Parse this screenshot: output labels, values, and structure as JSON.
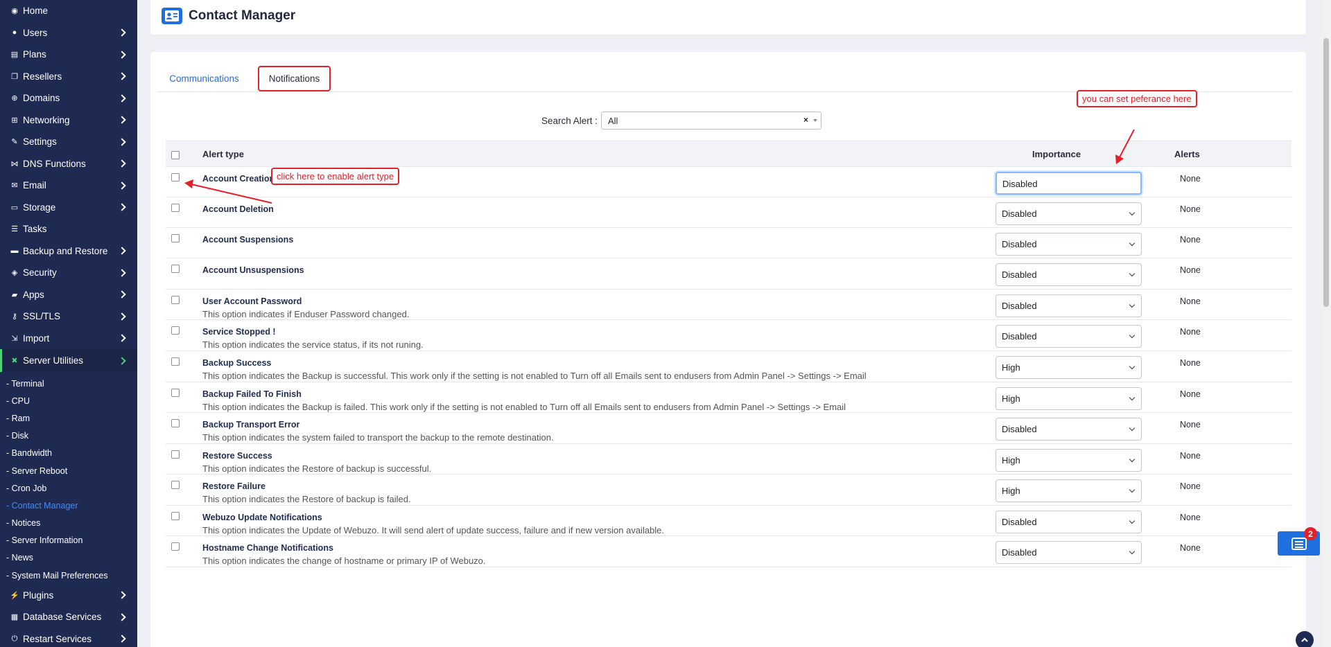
{
  "sidebar": {
    "items": [
      {
        "label": "Home",
        "icon": "home-icon",
        "has_children": false
      },
      {
        "label": "Users",
        "icon": "user-icon",
        "has_children": true
      },
      {
        "label": "Plans",
        "icon": "plans-icon",
        "has_children": true
      },
      {
        "label": "Resellers",
        "icon": "resellers-icon",
        "has_children": true
      },
      {
        "label": "Domains",
        "icon": "globe-icon",
        "has_children": true
      },
      {
        "label": "Networking",
        "icon": "network-icon",
        "has_children": true
      },
      {
        "label": "Settings",
        "icon": "wrench-icon",
        "has_children": true
      },
      {
        "label": "DNS Functions",
        "icon": "dns-icon",
        "has_children": true
      },
      {
        "label": "Email",
        "icon": "envelope-icon",
        "has_children": true
      },
      {
        "label": "Storage",
        "icon": "storage-icon",
        "has_children": true
      },
      {
        "label": "Tasks",
        "icon": "tasks-icon",
        "has_children": false
      },
      {
        "label": "Backup and Restore",
        "icon": "backup-icon",
        "has_children": true
      },
      {
        "label": "Security",
        "icon": "shield-icon",
        "has_children": true
      },
      {
        "label": "Apps",
        "icon": "apps-icon",
        "has_children": true
      },
      {
        "label": "SSL/TLS",
        "icon": "key-icon",
        "has_children": true
      },
      {
        "label": "Import",
        "icon": "import-icon",
        "has_children": true
      },
      {
        "label": "Server Utilities",
        "icon": "tools-icon",
        "has_children": true
      }
    ],
    "sub_items": [
      "- Terminal",
      "- CPU",
      "- Ram",
      "- Disk",
      "- Bandwidth",
      "- Server Reboot",
      "- Cron Job",
      "- Contact Manager",
      "- Notices",
      "- Server Information",
      "- News",
      "- System Mail Preferences"
    ],
    "bottom_items": [
      {
        "label": "Plugins",
        "icon": "plug-icon"
      },
      {
        "label": "Database Services",
        "icon": "database-icon"
      },
      {
        "label": "Restart Services",
        "icon": "power-icon"
      }
    ]
  },
  "header": {
    "title": "Contact Manager",
    "icon": "contact-card-icon"
  },
  "tabs": [
    {
      "label": "Communications"
    },
    {
      "label": "Notifications"
    }
  ],
  "search": {
    "label": "Search Alert :",
    "value": "All",
    "clear": "×"
  },
  "table": {
    "headers": {
      "alert_type": "Alert type",
      "importance": "Importance",
      "alerts": "Alerts"
    },
    "rows": [
      {
        "title": "Account Creation",
        "desc": "",
        "importance": "Disabled",
        "alerts": "None"
      },
      {
        "title": "Account Deletion",
        "desc": "",
        "importance": "Disabled",
        "alerts": "None"
      },
      {
        "title": "Account Suspensions",
        "desc": "",
        "importance": "Disabled",
        "alerts": "None"
      },
      {
        "title": "Account Unsuspensions",
        "desc": "",
        "importance": "Disabled",
        "alerts": "None"
      },
      {
        "title": "User Account Password",
        "desc": "This option indicates if Enduser Password changed.",
        "importance": "Disabled",
        "alerts": "None"
      },
      {
        "title": "Service Stopped !",
        "desc": "This option indicates the service status, if its not runing.",
        "importance": "Disabled",
        "alerts": "None"
      },
      {
        "title": "Backup Success",
        "desc": "This option indicates the Backup is successful. This work only if the setting is not enabled to Turn off all Emails sent to endusers from Admin Panel -> Settings -> Email",
        "importance": "High",
        "alerts": "None"
      },
      {
        "title": "Backup Failed To Finish",
        "desc": "This option indicates the Backup is failed. This work only if the setting is not enabled to Turn off all Emails sent to endusers from Admin Panel -> Settings -> Email",
        "importance": "High",
        "alerts": "None"
      },
      {
        "title": "Backup Transport Error",
        "desc": "This option indicates the system failed to transport the backup to the remote destination.",
        "importance": "Disabled",
        "alerts": "None"
      },
      {
        "title": "Restore Success",
        "desc": "This option indicates the Restore of backup is successful.",
        "importance": "High",
        "alerts": "None"
      },
      {
        "title": "Restore Failure",
        "desc": "This option indicates the Restore of backup is failed.",
        "importance": "High",
        "alerts": "None"
      },
      {
        "title": "Webuzo Update Notifications",
        "desc": "This option indicates the Update of Webuzo. It will send alert of update success, failure and if new version available.",
        "importance": "Disabled",
        "alerts": "None"
      },
      {
        "title": "Hostname Change Notifications",
        "desc": "This option indicates the change of hostname or primary IP of Webuzo.",
        "importance": "Disabled",
        "alerts": "None"
      }
    ]
  },
  "annotations": {
    "enable_hint": "click here to enable alert type",
    "preference_hint": "you can set peferance here"
  },
  "notifications_badge": "2",
  "colors": {
    "sidebar_bg": "#1f2a52",
    "accent": "#1f6fe0",
    "annotation": "#e5202a",
    "active_green": "#4fd07a"
  }
}
